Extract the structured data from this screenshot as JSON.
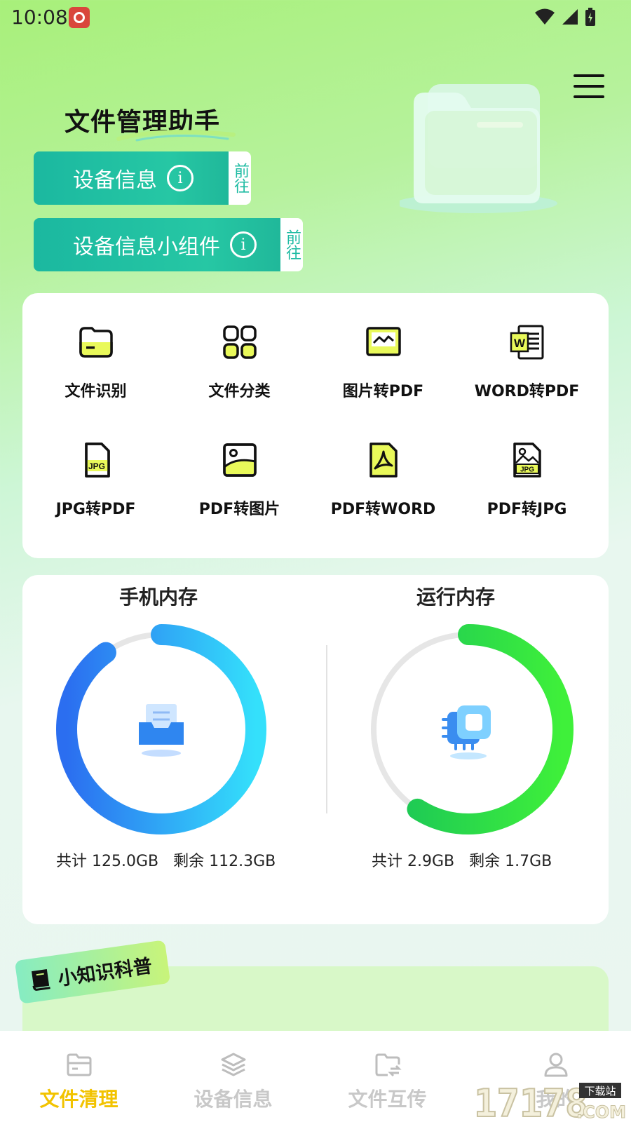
{
  "status_bar": {
    "time": "10:08"
  },
  "header": {
    "app_title": "文件管理助手",
    "device_info_btn": {
      "label": "设备信息",
      "info_icon": "i",
      "go": "前往"
    },
    "widget_btn": {
      "label": "设备信息小组件",
      "info_icon": "i",
      "go": "前往"
    }
  },
  "tools": [
    {
      "label": "文件识别",
      "icon": "folder-icon"
    },
    {
      "label": "文件分类",
      "icon": "grid-icon"
    },
    {
      "label": "图片转PDF",
      "icon": "image-icon"
    },
    {
      "label": "WORD转PDF",
      "icon": "word-icon"
    },
    {
      "label": "JPG转PDF",
      "icon": "jpg-file-icon"
    },
    {
      "label": "PDF转图片",
      "icon": "picture-icon"
    },
    {
      "label": "PDF转WORD",
      "icon": "pdf-icon"
    },
    {
      "label": "PDF转JPG",
      "icon": "jpg-image-icon"
    }
  ],
  "storage": {
    "phone": {
      "title": "手机内存",
      "total_label": "共计 125.0GB",
      "free_label": "剩余 112.3GB",
      "used_fraction": 0.9
    },
    "ram": {
      "title": "运行内存",
      "total_label": "共计 2.9GB",
      "free_label": "剩余 1.7GB",
      "used_fraction": 0.59
    }
  },
  "knowledge": {
    "tag": "小知识科普"
  },
  "bottom_nav": [
    {
      "label": "文件清理",
      "icon": "folder-icon",
      "active": true
    },
    {
      "label": "设备信息",
      "icon": "layers-icon",
      "active": false
    },
    {
      "label": "文件互传",
      "icon": "folder-transfer-icon",
      "active": false
    },
    {
      "label": "我的",
      "icon": "user-icon",
      "active": false
    }
  ],
  "watermark": {
    "text": "17178",
    "sub": "下载站",
    "domain": ".COM"
  },
  "colors": {
    "accent_teal": "#1bb8a0",
    "nav_active": "#f2c300",
    "phone_ring_start": "#2b6ef0",
    "phone_ring_end": "#34e0fb",
    "ram_ring_start": "#17c25a",
    "ram_ring_end": "#3ff03a"
  }
}
